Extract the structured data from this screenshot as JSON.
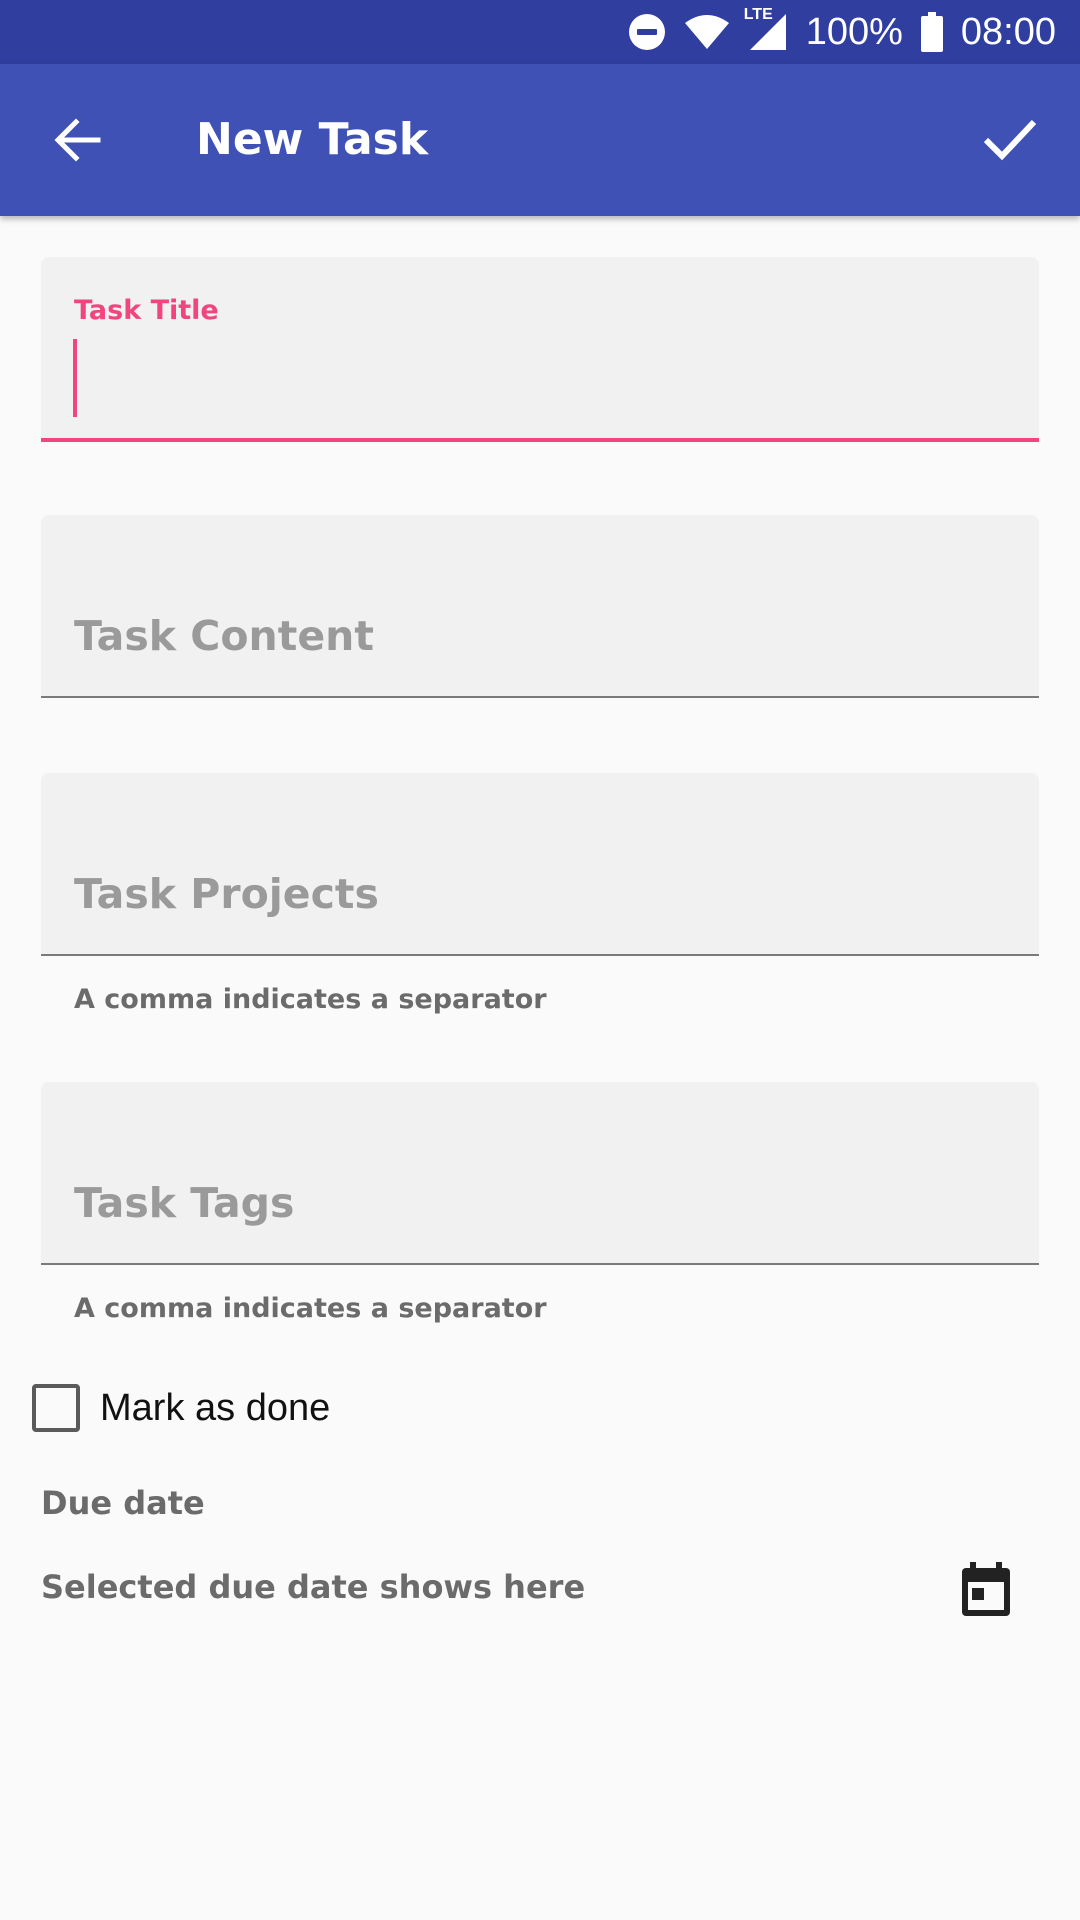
{
  "status_bar": {
    "icons": [
      "do-not-disturb-icon",
      "wifi-icon",
      "lte-signal-icon",
      "battery-icon"
    ],
    "lte_label": "LTE",
    "battery": "100%",
    "time": "08:00"
  },
  "app_bar": {
    "title": "New Task",
    "back_icon": "arrow-back-icon",
    "confirm_icon": "check-icon"
  },
  "form": {
    "title_field": {
      "label": "Task Title",
      "value": "",
      "focused": true
    },
    "content_field": {
      "placeholder": "Task Content",
      "value": ""
    },
    "projects_field": {
      "placeholder": "Task Projects",
      "value": "",
      "helper": "A comma indicates a separator"
    },
    "tags_field": {
      "placeholder": "Task Tags",
      "value": "",
      "helper": "A comma indicates a separator"
    },
    "mark_done": {
      "label": "Mark as done",
      "checked": false
    },
    "due_date": {
      "label": "Due date",
      "value": "Selected due date shows here",
      "icon": "calendar-icon"
    }
  },
  "colors": {
    "status_bar": "#303f9f",
    "app_bar": "#3f51b5",
    "accent": "#f0457f",
    "field_bg": "#f1f1f1",
    "page_bg": "#fafafa"
  }
}
